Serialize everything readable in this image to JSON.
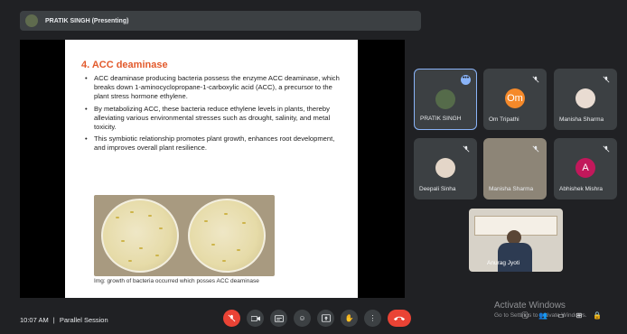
{
  "presenter": {
    "banner": "PRATIK SINGH (Presenting)"
  },
  "slide": {
    "title": "4. ACC deaminase",
    "bullets": [
      "ACC deaminase producing bacteria possess the enzyme ACC deaminase, which breaks down 1-aminocyclopropane-1-carboxylic acid (ACC), a precursor to the plant stress hormone ethylene.",
      "By metabolizing ACC, these bacteria reduce ethylene levels in plants, thereby alleviating various environmental stresses such as drought, salinity, and metal toxicity.",
      "This symbiotic relationship promotes plant growth, enhances root development, and improves overall plant resilience."
    ],
    "caption": "Img: growth of bacteria occurred which posses ACC deaminase"
  },
  "participants": [
    {
      "name": "PRATIK SINGH",
      "active": true
    },
    {
      "name": "Om Tripathi",
      "initials": "Om",
      "color": "#f5892a"
    },
    {
      "name": "Manisha Sharma"
    },
    {
      "name": "Deepali Sinha"
    },
    {
      "name": "Manisha Sharma"
    },
    {
      "name": "Abhishek Mishra",
      "initials": "A",
      "color": "#c2185b"
    },
    {
      "name": "Anurag Jyoti"
    }
  ],
  "bottombar": {
    "time": "10:07 AM",
    "separator": "|",
    "meeting": "Parallel Session"
  },
  "watermark": {
    "line1": "Activate Windows",
    "line2": "Go to Settings to activate Windows."
  },
  "colors": {
    "background": "#202124",
    "tile": "#3c4043",
    "accent": "#8ab4f8",
    "danger": "#ea4335",
    "slide_title": "#e25a2c"
  }
}
